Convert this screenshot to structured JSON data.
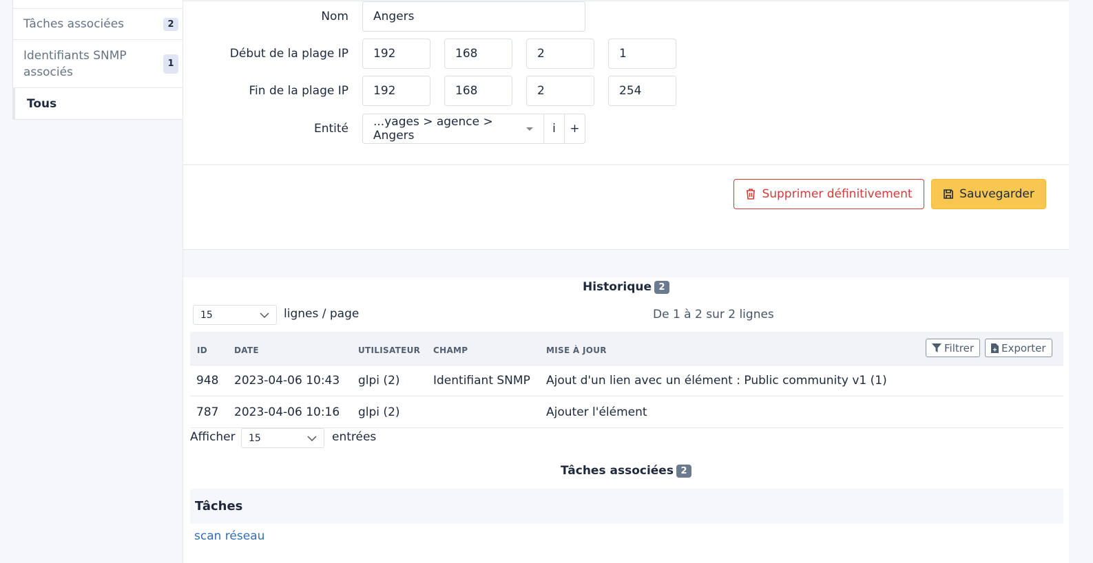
{
  "sidebar": {
    "items": [
      {
        "label": "",
        "count": ""
      },
      {
        "label": "Tâches associées",
        "count": "2"
      },
      {
        "label": "Identifiants SNMP associés",
        "count": "1"
      },
      {
        "label": "Tous"
      }
    ]
  },
  "form": {
    "name_label": "Nom",
    "name_value": "Angers",
    "ip_start_label": "Début de la plage IP",
    "ip_start": [
      "192",
      "168",
      "2",
      "1"
    ],
    "ip_end_label": "Fin de la plage IP",
    "ip_end": [
      "192",
      "168",
      "2",
      "254"
    ],
    "entity_label": "Entité",
    "entity_value": "...yages > agence > Angers",
    "entity_info": "i",
    "entity_add": "+"
  },
  "actions": {
    "delete_label": "Supprimer définitivement",
    "save_label": "Sauvegarder"
  },
  "history": {
    "title": "Historique",
    "count": "2",
    "per_page_value": "15",
    "per_page_label": "lignes / page",
    "range_text": "De 1 à 2 sur 2 lignes",
    "columns": [
      "ID",
      "DATE",
      "UTILISATEUR",
      "CHAMP",
      "MISE À JOUR"
    ],
    "filter_label": "Filtrer",
    "export_label": "Exporter",
    "rows": [
      {
        "id": "948",
        "date": "2023-04-06 10:43",
        "user": "glpi (2)",
        "field": "Identifiant SNMP",
        "update": "Ajout d'un lien avec un élément : Public community v1 (1)"
      },
      {
        "id": "787",
        "date": "2023-04-06 10:16",
        "user": "glpi (2)",
        "field": "",
        "update": "Ajouter l'élément"
      }
    ],
    "show_label": "Afficher",
    "show_value": "15",
    "entries_label": "entrées"
  },
  "tasks": {
    "title": "Tâches associées",
    "count": "2",
    "header": "Tâches",
    "link": "scan réseau"
  },
  "colors": {
    "accent": "#f9c74f",
    "danger": "#d63939",
    "link": "#2f6db5"
  }
}
